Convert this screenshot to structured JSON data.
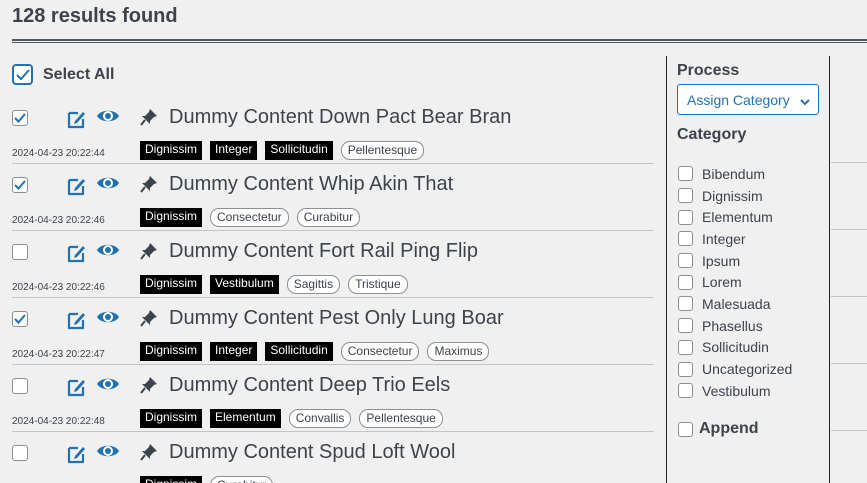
{
  "header": {
    "results_count": "128 results found"
  },
  "select_all": {
    "label": "Select All",
    "checked": true
  },
  "results": [
    {
      "title": "Dummy Content Down Pact Bear Bran",
      "date": "2024-04-23 20:22:44",
      "checked": true,
      "tags": [
        {
          "label": "Dignissim",
          "style": "dark"
        },
        {
          "label": "Integer",
          "style": "dark"
        },
        {
          "label": "Sollicitudin",
          "style": "dark"
        },
        {
          "label": "Pellentesque",
          "style": "light"
        }
      ]
    },
    {
      "title": "Dummy Content Whip Akin That",
      "date": "2024-04-23 20:22:46",
      "checked": true,
      "tags": [
        {
          "label": "Dignissim",
          "style": "dark"
        },
        {
          "label": "Consectetur",
          "style": "light"
        },
        {
          "label": "Curabitur",
          "style": "light"
        }
      ]
    },
    {
      "title": "Dummy Content Fort Rail Ping Flip",
      "date": "2024-04-23 20:22:46",
      "checked": false,
      "tags": [
        {
          "label": "Dignissim",
          "style": "dark"
        },
        {
          "label": "Vestibulum",
          "style": "dark"
        },
        {
          "label": "Sagittis",
          "style": "light"
        },
        {
          "label": "Tristique",
          "style": "light"
        }
      ]
    },
    {
      "title": "Dummy Content Pest Only Lung Boar",
      "date": "2024-04-23 20:22:47",
      "checked": true,
      "tags": [
        {
          "label": "Dignissim",
          "style": "dark"
        },
        {
          "label": "Integer",
          "style": "dark"
        },
        {
          "label": "Sollicitudin",
          "style": "dark"
        },
        {
          "label": "Consectetur",
          "style": "light"
        },
        {
          "label": "Maximus",
          "style": "light"
        }
      ]
    },
    {
      "title": "Dummy Content Deep Trio Eels",
      "date": "2024-04-23 20:22:48",
      "checked": false,
      "tags": [
        {
          "label": "Dignissim",
          "style": "dark"
        },
        {
          "label": "Elementum",
          "style": "dark"
        },
        {
          "label": "Convallis",
          "style": "light"
        },
        {
          "label": "Pellentesque",
          "style": "light"
        }
      ]
    },
    {
      "title": "Dummy Content Spud Loft Wool",
      "date": "",
      "checked": false,
      "tags": [
        {
          "label": "Dignissim",
          "style": "dark"
        },
        {
          "label": "Curabitur",
          "style": "light"
        }
      ]
    }
  ],
  "panel": {
    "process_label": "Process",
    "process_selected": "Assign Category",
    "category_label": "Category",
    "categories": [
      "Bibendum",
      "Dignissim",
      "Elementum",
      "Integer",
      "Ipsum",
      "Lorem",
      "Malesuada",
      "Phasellus",
      "Sollicitudin",
      "Uncategorized",
      "Vestibulum"
    ],
    "append_label": "Append"
  },
  "colors": {
    "accent": "#2271b1",
    "tag_dark": "#000000",
    "text": "#3c434a",
    "background": "#f0f0f1"
  },
  "icons": {
    "edit": "edit-icon",
    "view": "eye-icon",
    "sticky": "pin-icon",
    "dropdown": "chevron-down-icon"
  }
}
